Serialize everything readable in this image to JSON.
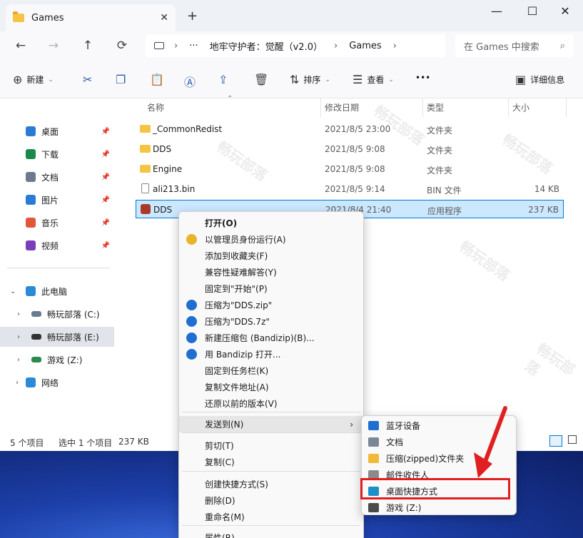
{
  "window": {
    "tab_title": "Games",
    "tab_close": "✕",
    "new_tab": "+",
    "min": "—",
    "max": "☐",
    "close": "✕"
  },
  "nav": {
    "back": "←",
    "forward": "→",
    "up": "↑",
    "refresh": "⟳"
  },
  "address": {
    "more": "···",
    "crumb1": "地牢守护者：觉醒（v2.0）",
    "crumb2": "Games",
    "sep": "›"
  },
  "search": {
    "placeholder": "在 Games 中搜索",
    "icon": "⌕"
  },
  "toolbar": {
    "new_label": "新建",
    "sort_label": "排序",
    "view_label": "查看",
    "more": "•••",
    "details_label": "详细信息"
  },
  "sidebar": {
    "quick": [
      {
        "label": "桌面",
        "color": "#2a7bd6"
      },
      {
        "label": "下载",
        "color": "#1a8a4a"
      },
      {
        "label": "文档",
        "color": "#6b7a8f"
      },
      {
        "label": "图片",
        "color": "#2a7bd6"
      },
      {
        "label": "音乐",
        "color": "#e0573a"
      },
      {
        "label": "视频",
        "color": "#7a3fb8"
      }
    ],
    "this_pc": "此电脑",
    "drives": [
      {
        "label": "畅玩部落 (C:)"
      },
      {
        "label": "畅玩部落 (E:)"
      },
      {
        "label": "游戏 (Z:)"
      }
    ],
    "network": "网络"
  },
  "columns": {
    "name": "名称",
    "date": "修改日期",
    "type": "类型",
    "size": "大小"
  },
  "files": [
    {
      "name": "_CommonRedist",
      "date": "2021/8/5 23:00",
      "type": "文件夹",
      "size": ""
    },
    {
      "name": "DDS",
      "date": "2021/8/5 9:08",
      "type": "文件夹",
      "size": ""
    },
    {
      "name": "Engine",
      "date": "2021/8/5 9:08",
      "type": "文件夹",
      "size": ""
    },
    {
      "name": "ali213.bin",
      "date": "2021/8/5 9:14",
      "type": "BIN 文件",
      "size": "14 KB"
    },
    {
      "name": "DDS",
      "date": "2021/8/4 21:40",
      "type": "应用程序",
      "size": "237 KB"
    }
  ],
  "status": {
    "count": "5 个项目",
    "selected": "选中 1 个项目",
    "size": "237 KB"
  },
  "context_menu": {
    "items": [
      "打开(O)",
      "以管理员身份运行(A)",
      "添加到收藏夹(F)",
      "兼容性疑难解答(Y)",
      "固定到\"开始\"(P)",
      "压缩为\"DDS.zip\"",
      "压缩为\"DDS.7z\"",
      "新建压缩包 (Bandizip)(B)...",
      "用 Bandizip 打开...",
      "固定到任务栏(K)",
      "复制文件地址(A)",
      "还原以前的版本(V)",
      "发送到(N)",
      "剪切(T)",
      "复制(C)",
      "创建快捷方式(S)",
      "删除(D)",
      "重命名(M)",
      "属性(R)"
    ],
    "submenu_arrow": "›"
  },
  "sendto_menu": {
    "items": [
      {
        "label": "蓝牙设备",
        "color": "#1e6fd0"
      },
      {
        "label": "文档",
        "color": "#7a8796"
      },
      {
        "label": "压缩(zipped)文件夹",
        "color": "#f0b93a"
      },
      {
        "label": "邮件收件人",
        "color": "#8a8a8a"
      },
      {
        "label": "桌面快捷方式",
        "color": "#1d8fc7"
      },
      {
        "label": "游戏 (Z:)",
        "color": "#4a4a4a"
      }
    ]
  },
  "colors": {
    "accent": "#0078d4",
    "highlight_box": "#e02020",
    "selection": "#cce8ff"
  }
}
